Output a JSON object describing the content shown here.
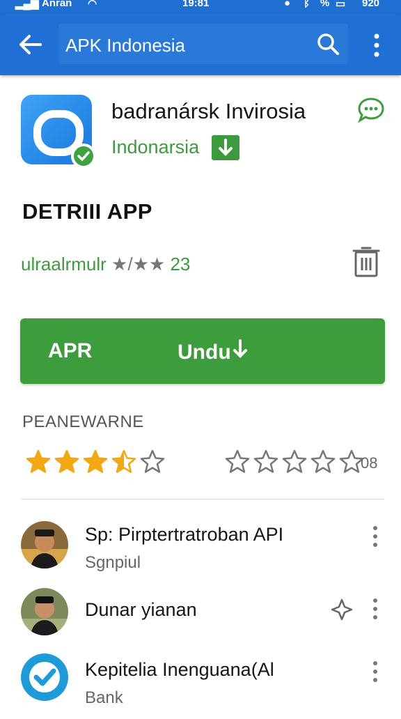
{
  "status_bar": {
    "carrier": "Anran",
    "time": "19:81",
    "battery": "920"
  },
  "appbar": {
    "search_text": "APK Indonesia"
  },
  "app": {
    "title": "badranársk Invirosia",
    "developer": "Indonarsia"
  },
  "section": {
    "title": "DETRIII APP"
  },
  "rating_line": {
    "text": "ulraalrmulr",
    "stars_text": "★/★★",
    "count": "23"
  },
  "primary_button": {
    "label_left": "APR",
    "label_right": "Undu"
  },
  "reviews": {
    "heading": "PEANEWARNE",
    "left_rating": 3.5,
    "left_max": 5,
    "right_rating": 0,
    "right_max": 5,
    "count": "08"
  },
  "list": [
    {
      "title": "Sp: Pirptertratroban API",
      "subtitle": "Sgnpiul"
    },
    {
      "title": "Dunar yianan",
      "subtitle": ""
    },
    {
      "title": "Kepitelia Inenguana(Al",
      "subtitle": "Bank"
    }
  ],
  "colors": {
    "appbar": "#1f6fd4",
    "accent_green": "#3d9d3d",
    "star_gold": "#f3a712"
  }
}
